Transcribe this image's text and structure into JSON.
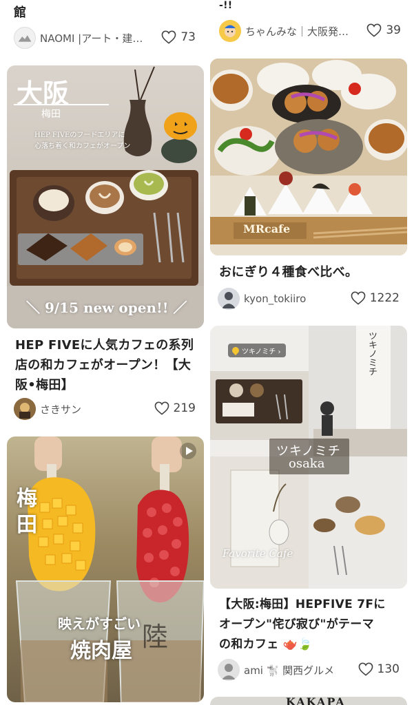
{
  "cards": {
    "top_left": {
      "title_tail": "館",
      "author": "NAOMI |アート・建…",
      "likes": "73"
    },
    "top_right": {
      "title_tail": "-!!",
      "author": "ちゃんみな｜大阪発…",
      "likes": "39"
    },
    "osaka_cafe": {
      "overlay_city": "大阪",
      "overlay_area": "梅田",
      "overlay_desc_1": "HEP FIVEのフードエリアに",
      "overlay_desc_2": "心落ち着く和カフェがオープン",
      "overlay_banner": "＼ 9/15 new open!! ／",
      "title_line1": "HEP FIVEに人気カフェの系列",
      "title_line2": "店の和カフェがオープン！【大",
      "title_line3": "阪•梅田】",
      "author": "さきサン",
      "likes": "219"
    },
    "onigiri": {
      "overlay_sign": "MRcafe",
      "title": "おにぎり４種食べ比べ。",
      "author": "kyon_tokiiro",
      "likes": "1222"
    },
    "tsukinomichi": {
      "location_tag": "ツキノミチ ›",
      "overlay_main_1": "ツキノミチ",
      "overlay_main_2": "osaka",
      "overlay_sign": "ツキノミチ",
      "overlay_script": "Favorite Cafe",
      "title_line1": "【大阪:梅田】HEPFIVE 7Fに",
      "title_line2": "オープン\"侘び寂び\"がテーマ",
      "title_line3": "の和カフェ 🫖🍃",
      "author": "ami 🐩 関西グルメ",
      "likes": "130"
    },
    "yakiniku": {
      "overlay_left": "梅田",
      "overlay_middle_1": "映えがすごい",
      "overlay_middle_2": "焼肉屋",
      "overlay_right": "陸"
    },
    "bottom_right": {
      "overlay_text": "KAKAPA"
    }
  }
}
